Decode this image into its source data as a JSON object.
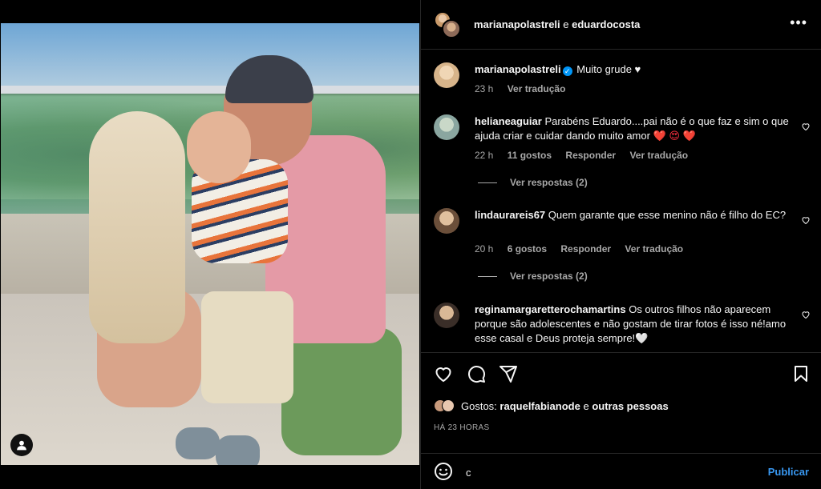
{
  "post": {
    "header_user1": "marianapolastreli",
    "header_and": "e",
    "header_user2": "eduardocosta",
    "more_icon": "more-horizontal-icon"
  },
  "caption": {
    "username": "marianapolastreli",
    "text": "Muito grude ♥",
    "time": "23 h",
    "translate": "Ver tradução"
  },
  "comments": [
    {
      "username": "helianeaguiar",
      "text_before": "Parabéns Eduardo....pai não é o que faz e sim o que ajuda criar e cuidar dando muito amor",
      "emojis": "❤️ 😍 ❤️",
      "time": "22 h",
      "likes": "11 gostos",
      "reply": "Responder",
      "translate": "Ver tradução",
      "view_replies": "Ver respostas (2)"
    },
    {
      "username": "lindaurareis67",
      "text_before": "Quem garante que esse menino não é filho do EC?",
      "emojis": "",
      "time": "20 h",
      "likes": "6 gostos",
      "reply": "Responder",
      "translate": "Ver tradução",
      "view_replies": "Ver respostas (2)"
    },
    {
      "username": "reginamargaretterochamartins",
      "text_before": "Os outros filhos não aparecem porque são adolescentes e não gostam de tirar fotos é isso né!amo esse casal e Deus proteja sempre!🤍",
      "emojis": "",
      "time": "",
      "likes": "",
      "reply": "",
      "translate": "",
      "view_replies": ""
    }
  ],
  "actions": {
    "like_icon": "heart-icon",
    "comment_icon": "comment-icon",
    "share_icon": "share-icon",
    "save_icon": "bookmark-icon"
  },
  "likes_line": {
    "prefix": "Gostos:",
    "user": "raquelfabianode",
    "suffix": "e",
    "others": "outras pessoas"
  },
  "time_ago": "HÁ 23 HORAS",
  "composer": {
    "value": "c",
    "publish": "Publicar"
  },
  "colors": {
    "background": "#000000",
    "text": "#f5f5f5",
    "secondary": "#a8a8a8",
    "link_blue": "#3897f0",
    "verified": "#0095f6",
    "heart_red": "#ff3040"
  }
}
